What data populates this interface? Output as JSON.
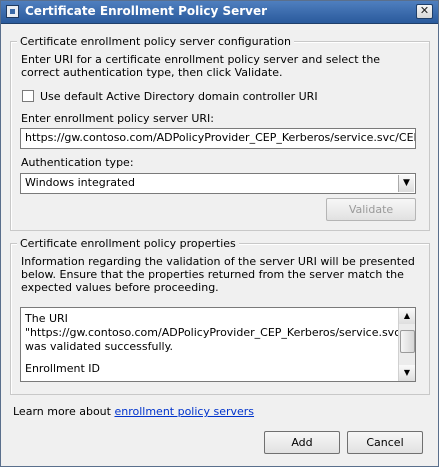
{
  "window": {
    "title": "Certificate Enrollment Policy Server",
    "close_glyph": "✕"
  },
  "config_group": {
    "legend": "Certificate enrollment policy server configuration",
    "instructions": "Enter URI for a certificate enrollment policy server and select the correct authentication type, then click Validate.",
    "use_default_checkbox": {
      "label": "Use default Active Directory domain controller URI",
      "checked": false
    },
    "uri_label": "Enter enrollment policy server URI:",
    "uri_value": "https://gw.contoso.com/ADPolicyProvider_CEP_Kerberos/service.svc/CEP",
    "auth_label": "Authentication type:",
    "auth_value": "Windows integrated",
    "validate_label": "Validate"
  },
  "properties_group": {
    "legend": "Certificate enrollment policy properties",
    "description": "Information regarding the validation of the server URI will be presented below. Ensure that the properties returned from the server match the expected values before proceeding.",
    "result_line1": "The URI",
    "result_line2": "\"https://gw.contoso.com/ADPolicyProvider_CEP_Kerberos/service.svc/CEP\"",
    "result_line3": "was validated successfully.",
    "result_line4": "Enrollment ID"
  },
  "footer": {
    "learn_more_prefix": "Learn more about",
    "learn_more_link": "enrollment policy servers",
    "add_label": "Add",
    "cancel_label": "Cancel"
  },
  "icons": {
    "dropdown_arrow": "▼",
    "scroll_up": "▲",
    "scroll_down": "▼"
  }
}
